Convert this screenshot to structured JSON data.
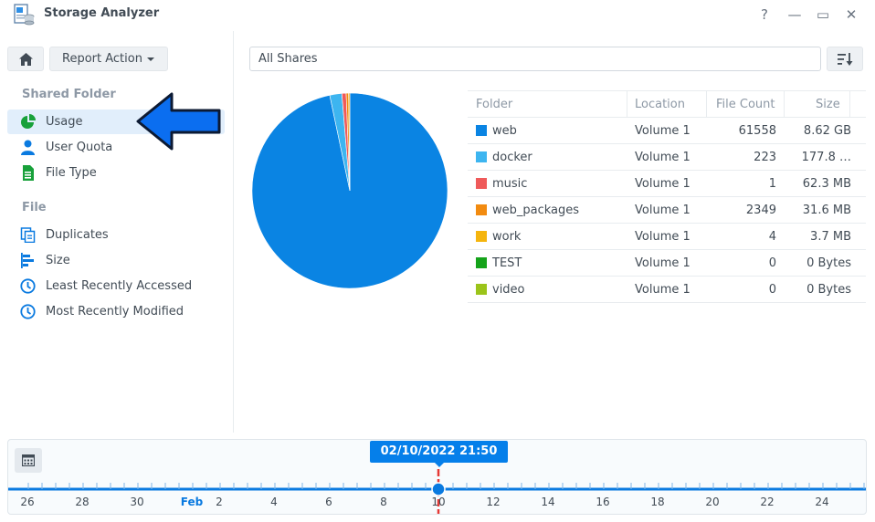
{
  "window": {
    "title": "Storage Analyzer",
    "controls": {
      "help": "?",
      "minimize": "—",
      "maximize": "▭",
      "close": "✕"
    }
  },
  "toolbar": {
    "report_action_label": "Report Action"
  },
  "sidebar": {
    "shared_folder_title": "Shared Folder",
    "shared_items": [
      {
        "label": "Usage",
        "icon": "pie-chart-icon",
        "active": true
      },
      {
        "label": "User Quota",
        "icon": "user-icon"
      },
      {
        "label": "File Type",
        "icon": "file-type-icon"
      }
    ],
    "file_title": "File",
    "file_items": [
      {
        "label": "Duplicates",
        "icon": "duplicates-icon"
      },
      {
        "label": "Size",
        "icon": "size-bars-icon"
      },
      {
        "label": "Least Recently Accessed",
        "icon": "clock-icon"
      },
      {
        "label": "Most Recently Modified",
        "icon": "clock-icon"
      }
    ]
  },
  "filter": {
    "value": "All Shares"
  },
  "table": {
    "headers": {
      "folder": "Folder",
      "location": "Location",
      "file_count": "File Count",
      "size": "Size"
    },
    "rows": [
      {
        "folder": "web",
        "location": "Volume 1",
        "file_count": "61558",
        "size": "8.62 GB",
        "color": "#0a84e3"
      },
      {
        "folder": "docker",
        "location": "Volume 1",
        "file_count": "223",
        "size": "177.8 …",
        "color": "#3db5f0"
      },
      {
        "folder": "music",
        "location": "Volume 1",
        "file_count": "1",
        "size": "62.3 MB",
        "color": "#ef5a5a"
      },
      {
        "folder": "web_packages",
        "location": "Volume 1",
        "file_count": "2349",
        "size": "31.6 MB",
        "color": "#f28b10"
      },
      {
        "folder": "work",
        "location": "Volume 1",
        "file_count": "4",
        "size": "3.7 MB",
        "color": "#f5b50e"
      },
      {
        "folder": "TEST",
        "location": "Volume 1",
        "file_count": "0",
        "size": "0 Bytes",
        "color": "#15a31a"
      },
      {
        "folder": "video",
        "location": "Volume 1",
        "file_count": "0",
        "size": "0 Bytes",
        "color": "#9bc41a"
      }
    ]
  },
  "pie_shares": [
    {
      "folder": "web",
      "fraction": 0.967,
      "color": "#0a84e3"
    },
    {
      "folder": "docker",
      "fraction": 0.02,
      "color": "#3db5f0"
    },
    {
      "folder": "music",
      "fraction": 0.007,
      "color": "#ef5a5a"
    },
    {
      "folder": "web_packages",
      "fraction": 0.004,
      "color": "#f28b10"
    },
    {
      "folder": "work",
      "fraction": 0.002,
      "color": "#f5b50e"
    }
  ],
  "timeline": {
    "selected_datetime": "02/10/2022 21:50",
    "labels": [
      "26",
      "28",
      "30",
      "Feb",
      "2",
      "4",
      "6",
      "8",
      "10",
      "12",
      "14",
      "16",
      "18",
      "20",
      "22",
      "24"
    ]
  }
}
